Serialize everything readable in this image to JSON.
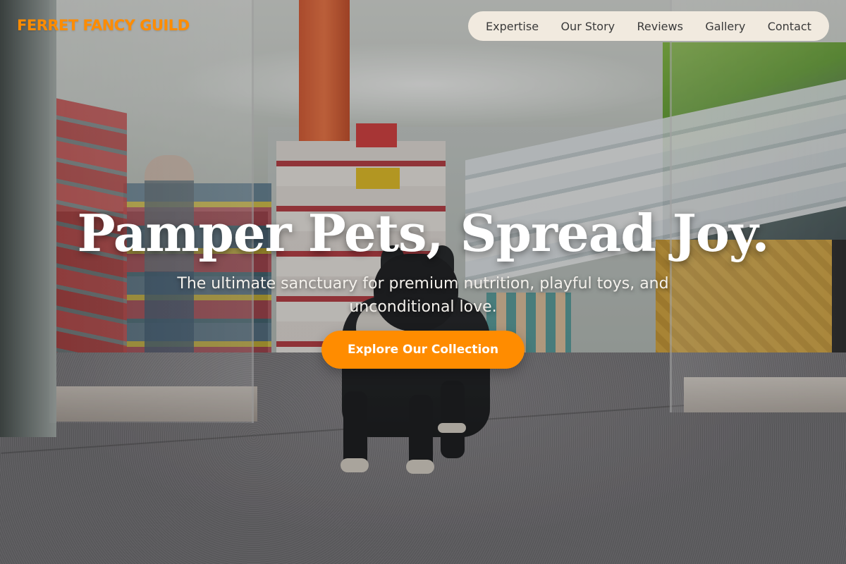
{
  "brand": {
    "name": "FERRET FANCY GUILD",
    "color": "#ff8c00"
  },
  "nav": {
    "items": [
      {
        "label": "Expertise"
      },
      {
        "label": "Our Story"
      },
      {
        "label": "Reviews"
      },
      {
        "label": "Gallery"
      },
      {
        "label": "Contact"
      }
    ]
  },
  "hero": {
    "title": "Pamper Pets, Spread Joy.",
    "subtitle": "The ultimate sanctuary for premium nutrition, playful toys, and unconditional love.",
    "cta_label": "Explore Our Collection",
    "cta_color": "#ff8c00"
  }
}
